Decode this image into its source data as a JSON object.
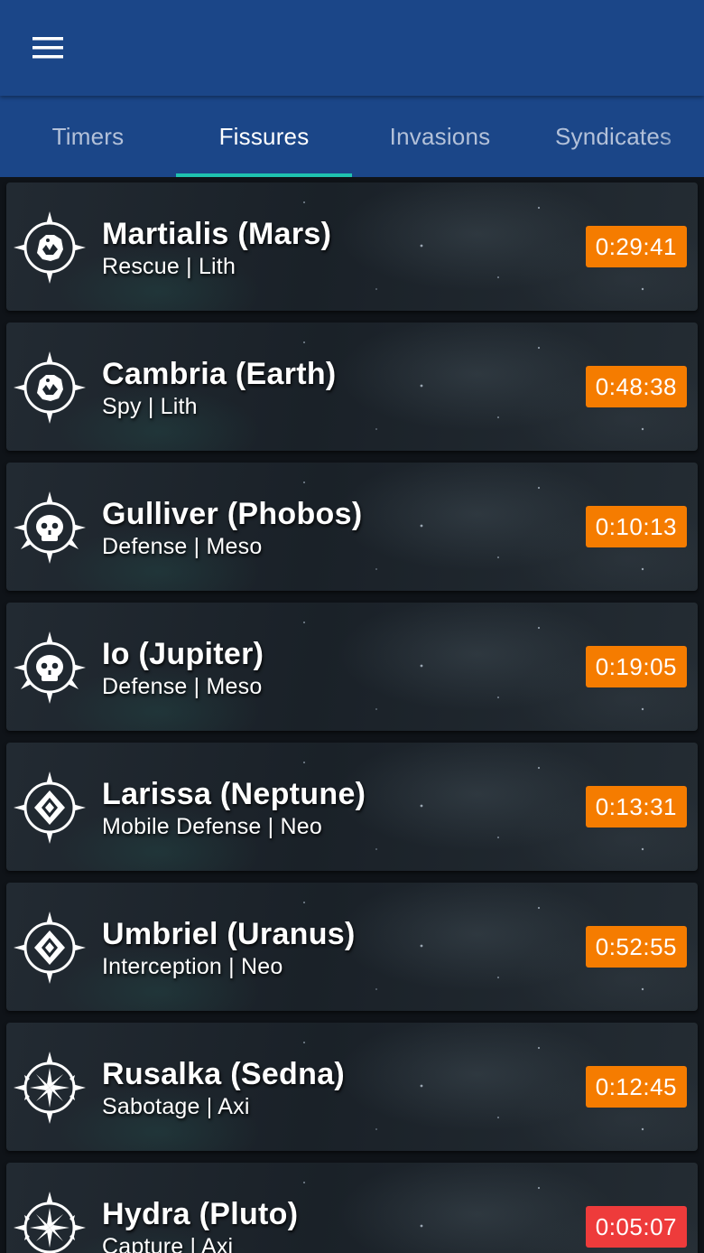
{
  "header": {
    "menu_icon": "hamburger-menu-icon",
    "background": "#1b4688"
  },
  "tabs": [
    {
      "label": "Timers",
      "active": false
    },
    {
      "label": "Fissures",
      "active": true
    },
    {
      "label": "Invasions",
      "active": false
    },
    {
      "label": "Syndicates",
      "active": false
    }
  ],
  "colors": {
    "accent": "#1fc3b0",
    "timer_normal": "#f57c00",
    "timer_urgent": "#ee3b3b"
  },
  "fissures": [
    {
      "node": "Martialis (Mars)",
      "details": "Rescue | Lith",
      "tier_icon": "lith-tier-icon",
      "timer": "0:29:41",
      "urgent": false
    },
    {
      "node": "Cambria (Earth)",
      "details": "Spy | Lith",
      "tier_icon": "lith-tier-icon",
      "timer": "0:48:38",
      "urgent": false
    },
    {
      "node": "Gulliver (Phobos)",
      "details": "Defense | Meso",
      "tier_icon": "meso-tier-icon",
      "timer": "0:10:13",
      "urgent": false
    },
    {
      "node": "Io (Jupiter)",
      "details": "Defense | Meso",
      "tier_icon": "meso-tier-icon",
      "timer": "0:19:05",
      "urgent": false
    },
    {
      "node": "Larissa (Neptune)",
      "details": "Mobile Defense | Neo",
      "tier_icon": "neo-tier-icon",
      "timer": "0:13:31",
      "urgent": false
    },
    {
      "node": "Umbriel (Uranus)",
      "details": "Interception | Neo",
      "tier_icon": "neo-tier-icon",
      "timer": "0:52:55",
      "urgent": false
    },
    {
      "node": "Rusalka (Sedna)",
      "details": "Sabotage | Axi",
      "tier_icon": "axi-tier-icon",
      "timer": "0:12:45",
      "urgent": false
    },
    {
      "node": "Hydra (Pluto)",
      "details": "Capture | Axi",
      "tier_icon": "axi-tier-icon",
      "timer": "0:05:07",
      "urgent": true
    }
  ]
}
